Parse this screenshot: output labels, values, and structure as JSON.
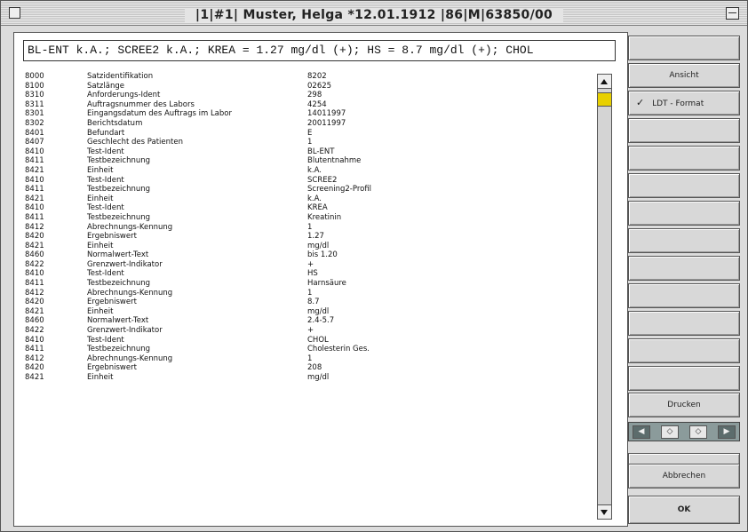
{
  "window": {
    "title": "|1|#1| Muster, Helga *12.01.1912 |86|M|63850/00"
  },
  "summary_line": "BL-ENT k.A.; SCREE2 k.A.; KREA = 1.27 mg/dl (+); HS = 8.7 mg/dl (+); CHOL",
  "records": [
    {
      "code": "8000",
      "label": "Satzidentifikation",
      "value": "8202"
    },
    {
      "code": "8100",
      "label": "Satzlänge",
      "value": "02625"
    },
    {
      "code": "8310",
      "label": "Anforderungs-Ident",
      "value": "298"
    },
    {
      "code": "8311",
      "label": "Auftragsnummer des Labors",
      "value": "4254"
    },
    {
      "code": "8301",
      "label": "Eingangsdatum des Auftrags im Labor",
      "value": "14011997"
    },
    {
      "code": "8302",
      "label": "Berichtsdatum",
      "value": "20011997"
    },
    {
      "code": "8401",
      "label": "Befundart",
      "value": "E"
    },
    {
      "code": "8407",
      "label": "Geschlecht des Patienten",
      "value": "1"
    },
    {
      "code": "8410",
      "label": "Test-Ident",
      "value": "BL-ENT"
    },
    {
      "code": "8411",
      "label": "Testbezeichnung",
      "value": "Blutentnahme"
    },
    {
      "code": "8421",
      "label": "Einheit",
      "value": "k.A."
    },
    {
      "code": "8410",
      "label": "Test-Ident",
      "value": "SCREE2"
    },
    {
      "code": "8411",
      "label": "Testbezeichnung",
      "value": "Screening2-Profil"
    },
    {
      "code": "8421",
      "label": "Einheit",
      "value": "k.A."
    },
    {
      "code": "8410",
      "label": "Test-Ident",
      "value": "KREA"
    },
    {
      "code": "8411",
      "label": "Testbezeichnung",
      "value": "Kreatinin"
    },
    {
      "code": "8412",
      "label": "Abrechnungs-Kennung",
      "value": "1"
    },
    {
      "code": "8420",
      "label": "Ergebniswert",
      "value": "1.27"
    },
    {
      "code": "8421",
      "label": "Einheit",
      "value": "mg/dl"
    },
    {
      "code": "8460",
      "label": "Normalwert-Text",
      "value": "bis 1.20"
    },
    {
      "code": "8422",
      "label": "Grenzwert-Indikator",
      "value": "+"
    },
    {
      "code": "8410",
      "label": "Test-Ident",
      "value": "HS"
    },
    {
      "code": "8411",
      "label": "Testbezeichnung",
      "value": "Harnsäure"
    },
    {
      "code": "8412",
      "label": "Abrechnungs-Kennung",
      "value": "1"
    },
    {
      "code": "8420",
      "label": "Ergebniswert",
      "value": "8.7"
    },
    {
      "code": "8421",
      "label": "Einheit",
      "value": "mg/dl"
    },
    {
      "code": "8460",
      "label": "Normalwert-Text",
      "value": "2.4-5.7"
    },
    {
      "code": "8422",
      "label": "Grenzwert-Indikator",
      "value": "+"
    },
    {
      "code": "8410",
      "label": "Test-Ident",
      "value": "CHOL"
    },
    {
      "code": "8411",
      "label": "Testbezeichnung",
      "value": "Cholesterin Ges."
    },
    {
      "code": "8412",
      "label": "Abrechnungs-Kennung",
      "value": "1"
    },
    {
      "code": "8420",
      "label": "Ergebniswert",
      "value": "208"
    },
    {
      "code": "8421",
      "label": "Einheit",
      "value": "mg/dl"
    }
  ],
  "sidebar": {
    "view_label": "Ansicht",
    "check_mark": "✓",
    "ldt_format_label": "LDT - Format",
    "print_label": "Drucken",
    "cancel_label": "Abbrechen",
    "ok_label": "OK"
  },
  "nav": {
    "first": "◀",
    "prev": "◇",
    "next": "◇",
    "last": "▶"
  },
  "colors": {
    "scroll_thumb": "#e8d000",
    "nav_group_bg": "#8b9b9b"
  }
}
